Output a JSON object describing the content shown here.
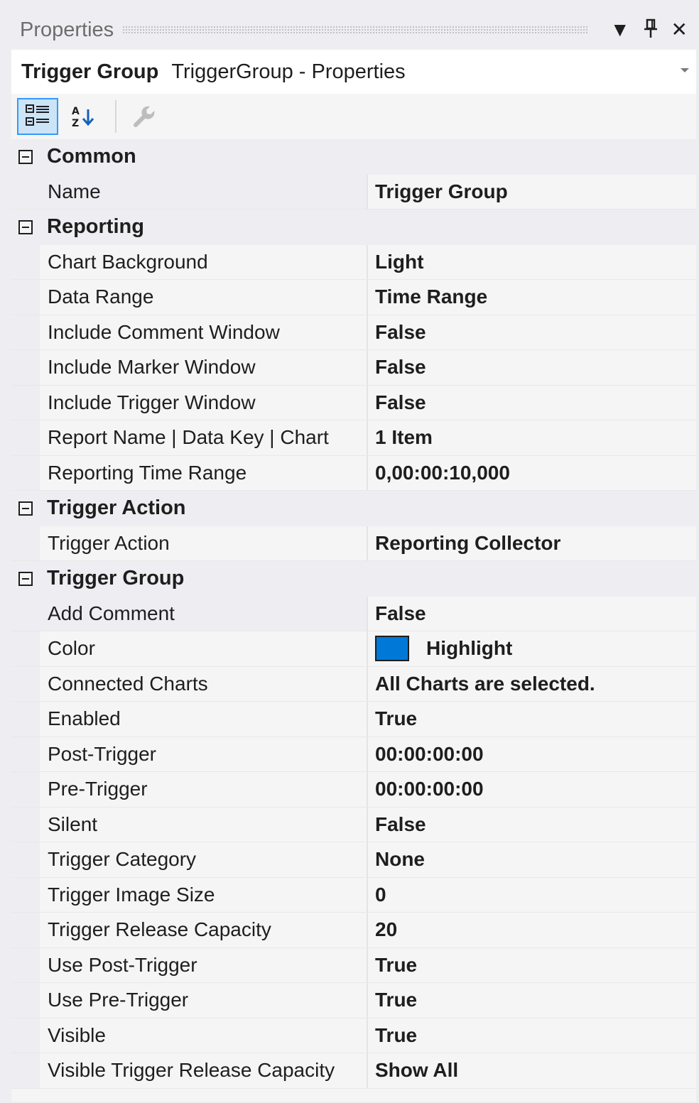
{
  "window": {
    "title": "Properties",
    "menu_icon": "▼",
    "pin_icon": "pin-icon",
    "close_icon": "✕"
  },
  "selector": {
    "type": "Trigger Group",
    "name": "TriggerGroup - Properties"
  },
  "toolbar": {
    "categorized_icon": "categorized-view-icon",
    "alphabetical_icon": "alphabetical-sort-icon",
    "property_pages_icon": "wrench-icon"
  },
  "categories": [
    {
      "label": "Common",
      "properties": [
        {
          "name": "Name",
          "value": "Trigger Group",
          "selected": true
        }
      ]
    },
    {
      "label": "Reporting",
      "properties": [
        {
          "name": "Chart Background",
          "value": "Light"
        },
        {
          "name": "Data Range",
          "value": "Time Range"
        },
        {
          "name": "Include Comment Window",
          "value": "False"
        },
        {
          "name": "Include Marker Window",
          "value": "False"
        },
        {
          "name": "Include Trigger Window",
          "value": "False"
        },
        {
          "name": "Report Name | Data Key | Chart",
          "value": "1 Item"
        },
        {
          "name": "Reporting Time Range",
          "value": "0,00:00:10,000"
        }
      ]
    },
    {
      "label": "Trigger Action",
      "properties": [
        {
          "name": "Trigger Action",
          "value": "Reporting Collector"
        }
      ]
    },
    {
      "label": "Trigger Group",
      "properties": [
        {
          "name": "Add Comment",
          "value": "False",
          "selected": true
        },
        {
          "name": "Color",
          "value": "Highlight",
          "swatch": "#0078d7"
        },
        {
          "name": "Connected Charts",
          "value": "All Charts are selected."
        },
        {
          "name": "Enabled",
          "value": "True"
        },
        {
          "name": "Post-Trigger",
          "value": "00:00:00:00"
        },
        {
          "name": "Pre-Trigger",
          "value": "00:00:00:00"
        },
        {
          "name": "Silent",
          "value": "False"
        },
        {
          "name": "Trigger Category",
          "value": "None"
        },
        {
          "name": "Trigger Image Size",
          "value": "0"
        },
        {
          "name": "Trigger Release Capacity",
          "value": "20"
        },
        {
          "name": "Use Post-Trigger",
          "value": "True"
        },
        {
          "name": "Use Pre-Trigger",
          "value": "True"
        },
        {
          "name": "Visible",
          "value": "True"
        },
        {
          "name": "Visible Trigger Release Capacity",
          "value": "Show All"
        }
      ]
    }
  ]
}
